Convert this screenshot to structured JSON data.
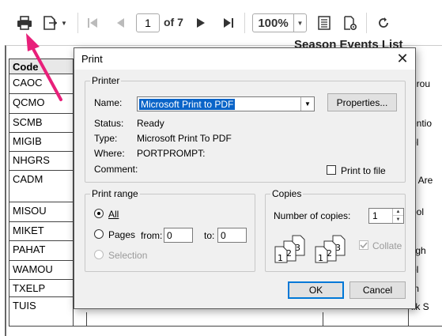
{
  "toolbar": {
    "page_current": "1",
    "page_of": "of 7",
    "zoom": "100%"
  },
  "report": {
    "title": "Season Events List",
    "code_header": "Code",
    "codes": [
      "CAOC",
      "QCMO",
      "SCMB",
      "MIGIB",
      "NHGRS",
      "CADM",
      "MISOU",
      "MIKET",
      "PAHAT",
      "WAMOU",
      "TXELP",
      "TUIS"
    ],
    "right_fragments": [
      "grou",
      "",
      "entio",
      "ol",
      "",
      "s Are",
      "ool",
      "",
      "ligh",
      "ol",
      "m",
      "lik S"
    ]
  },
  "dialog": {
    "title": "Print",
    "close_glyph": "✕",
    "printer": {
      "legend": "Printer",
      "name_label": "Name:",
      "name_value": "Microsoft Print to PDF",
      "properties_label": "Properties...",
      "status_label": "Status:",
      "status_value": "Ready",
      "type_label": "Type:",
      "type_value": "Microsoft Print To PDF",
      "where_label": "Where:",
      "where_value": "PORTPROMPT:",
      "comment_label": "Comment:",
      "print_to_file_label": "Print to file"
    },
    "range": {
      "legend": "Print range",
      "all_label": "All",
      "pages_label": "Pages",
      "from_label": "from:",
      "from_value": "0",
      "to_label": "to:",
      "to_value": "0",
      "selection_label": "Selection"
    },
    "copies": {
      "legend": "Copies",
      "number_label": "Number of copies:",
      "number_value": "1",
      "collate_label": "Collate"
    },
    "ok_label": "OK",
    "cancel_label": "Cancel"
  },
  "colors": {
    "selection_blue": "#0a64c8",
    "arrow_pink": "#e8207a",
    "dialog_bg": "#f0f0f0"
  }
}
